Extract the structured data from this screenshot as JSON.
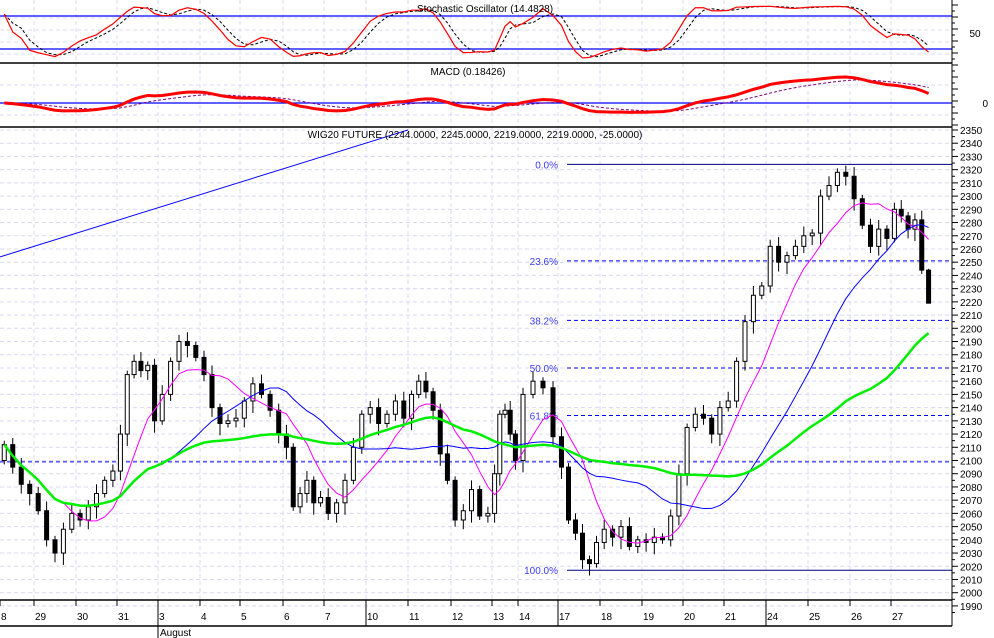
{
  "chart_data": {
    "type": "candlestick",
    "title": "WIG20 FUTURE (2244.0000, 2245.0000, 2219.0000, 2219.0000, -25.0000)",
    "ylim": [
      1990,
      2350
    ],
    "ytick_step": 10,
    "grid": true,
    "month_label": "August",
    "days": [
      {
        "label": "8",
        "closes": [
          2112,
          2095,
          2082,
          2075
        ]
      },
      {
        "label": "29",
        "closes": [
          2062,
          2040,
          2030,
          2048,
          2060
        ]
      },
      {
        "label": "30",
        "closes": [
          2055,
          2065,
          2075,
          2085,
          2092
        ]
      },
      {
        "label": "31",
        "closes": [
          2120,
          2165,
          2175,
          2168,
          2172,
          2130
        ]
      },
      {
        "label": "3",
        "closes": [
          2150,
          2175,
          2190,
          2187,
          2178
        ]
      },
      {
        "label": "4",
        "closes": [
          2165,
          2140,
          2128,
          2130,
          2132
        ]
      },
      {
        "label": "5",
        "closes": [
          2145,
          2158,
          2150,
          2138,
          2120
        ]
      },
      {
        "label": "6",
        "closes": [
          2110,
          2065,
          2075,
          2085,
          2068,
          2072
        ]
      },
      {
        "label": "7",
        "closes": [
          2060,
          2068,
          2085,
          2110,
          2135
        ]
      },
      {
        "label": "10",
        "closes": [
          2140,
          2128,
          2135,
          2145,
          2132
        ]
      },
      {
        "label": "11",
        "closes": [
          2150,
          2160,
          2152,
          2138,
          2105,
          2085
        ]
      },
      {
        "label": "12",
        "closes": [
          2055,
          2062,
          2078,
          2058,
          2060
        ]
      },
      {
        "label": "13",
        "closes": [
          2090,
          2135,
          2138,
          2120,
          2100
        ]
      },
      {
        "label": "14",
        "closes": [
          2150,
          2160,
          2155,
          2118
        ]
      },
      {
        "label": "17",
        "closes": [
          2095,
          2055,
          2045,
          2025,
          2022,
          2038
        ]
      },
      {
        "label": "18",
        "closes": [
          2048,
          2042,
          2050,
          2035,
          2040
        ]
      },
      {
        "label": "19",
        "closes": [
          2038,
          2042,
          2040,
          2058,
          2090
        ]
      },
      {
        "label": "20",
        "closes": [
          2125,
          2135,
          2132,
          2120,
          2140
        ]
      },
      {
        "label": "21",
        "closes": [
          2145,
          2175,
          2205,
          2225,
          2232
        ]
      },
      {
        "label": "24",
        "closes": [
          2262,
          2250,
          2255,
          2262,
          2270
        ]
      },
      {
        "label": "25",
        "closes": [
          2272,
          2300,
          2308,
          2318,
          2315
        ]
      },
      {
        "label": "26",
        "closes": [
          2298,
          2278,
          2262,
          2275,
          2268
        ]
      },
      {
        "label": "27",
        "closes": [
          2290,
          2285,
          2275,
          2282,
          2244,
          2219
        ]
      }
    ],
    "first_open": 2100,
    "horizontal_line": 2099,
    "trendline": {
      "from_price": 2254,
      "to_price": 2350,
      "to_day": "11"
    },
    "fibonacci": [
      {
        "label": "0.0%",
        "value": 2324
      },
      {
        "label": "23.6%",
        "value": 2251
      },
      {
        "label": "38.2%",
        "value": 2206
      },
      {
        "label": "50.0%",
        "value": 2170
      },
      {
        "label": "61.8%",
        "value": 2134
      },
      {
        "label": "100.0%",
        "value": 2017
      }
    ],
    "moving_averages": [
      {
        "period": 8,
        "color": "#ff00ff"
      },
      {
        "period": 20,
        "color": "#0000ff"
      },
      {
        "period": 40,
        "color": "#00ee00"
      }
    ],
    "stochastic": {
      "label": "Stochastic Oscillator (14.4828)",
      "levels": [
        20,
        80
      ],
      "axis_label": "50"
    },
    "macd": {
      "label": "MACD (0.18426)",
      "axis_label": "0"
    },
    "colors": {
      "line": "#0000ff",
      "osc": "#ff0000",
      "grid": "#d8d8f4",
      "fib": "#3a3aff"
    }
  }
}
